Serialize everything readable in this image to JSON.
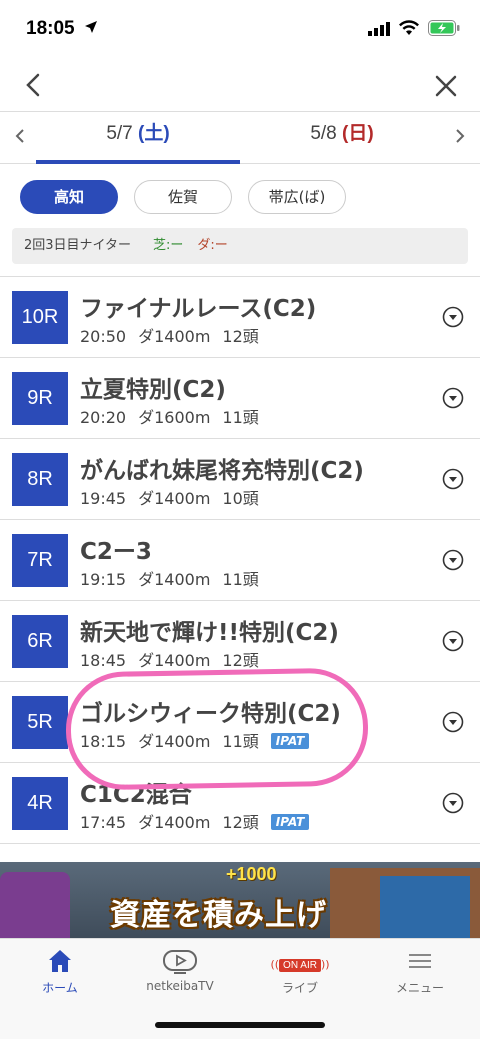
{
  "status_bar": {
    "time": "18:05"
  },
  "date_tabs": [
    {
      "date": "5/7",
      "day": "(土)"
    },
    {
      "date": "5/8",
      "day": "(日)"
    }
  ],
  "venues": [
    "高知",
    "佐賀",
    "帯広(ば)"
  ],
  "info": {
    "meeting": "2回3日目ナイター",
    "turf": "芝:ー",
    "dirt": "ダ:ー"
  },
  "races": [
    {
      "num": "10R",
      "name": "ファイナルレース(C2)",
      "time": "20:50",
      "course": "ダ1400m",
      "runners": "12頭",
      "ipat": ""
    },
    {
      "num": "9R",
      "name": "立夏特別(C2)",
      "time": "20:20",
      "course": "ダ1600m",
      "runners": "11頭",
      "ipat": ""
    },
    {
      "num": "8R",
      "name": "がんばれ妹尾将充特別(C2)",
      "time": "19:45",
      "course": "ダ1400m",
      "runners": "10頭",
      "ipat": ""
    },
    {
      "num": "7R",
      "name": "C2ー3",
      "time": "19:15",
      "course": "ダ1400m",
      "runners": "11頭",
      "ipat": ""
    },
    {
      "num": "6R",
      "name": "新天地で輝け!!特別(C2)",
      "time": "18:45",
      "course": "ダ1400m",
      "runners": "12頭",
      "ipat": ""
    },
    {
      "num": "5R",
      "name": "ゴルシウィーク特別(C2)",
      "time": "18:15",
      "course": "ダ1400m",
      "runners": "11頭",
      "ipat": "IPAT"
    },
    {
      "num": "4R",
      "name": "C1C2混合",
      "time": "17:45",
      "course": "ダ1400m",
      "runners": "12頭",
      "ipat": "IPAT"
    }
  ],
  "banner": {
    "bonus": "+1000",
    "title": "資産を積み上げ"
  },
  "bottom_nav": [
    {
      "label": "ホーム",
      "icon": "home-icon"
    },
    {
      "label": "netkeibaTV",
      "icon": "tv-icon"
    },
    {
      "label": "ライブ",
      "badge": "ON AIR",
      "icon": "live-icon"
    },
    {
      "label": "メニュー",
      "icon": "menu-icon"
    }
  ],
  "colors": {
    "accent": "#2b4bb8",
    "saturday": "#2b4bb8",
    "sunday": "#b32a2a",
    "ipat": "#4a90d9",
    "highlight": "#f06bb9"
  }
}
